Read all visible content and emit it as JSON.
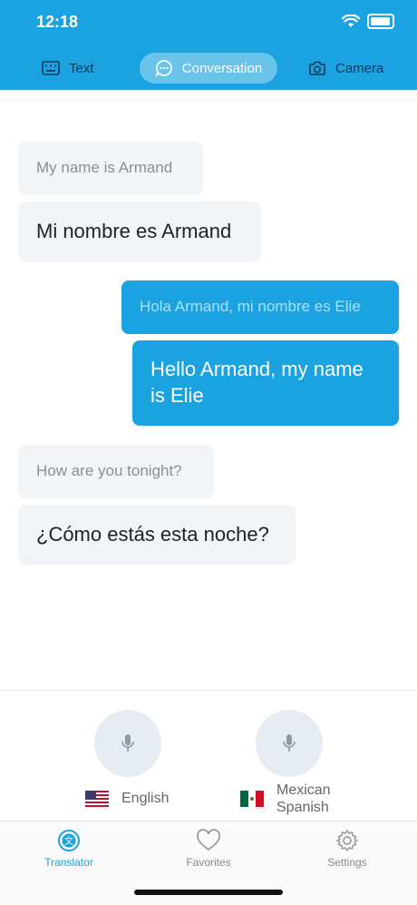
{
  "status_bar": {
    "time": "12:18"
  },
  "tabs": [
    {
      "label": "Text",
      "icon": "keyboard-icon"
    },
    {
      "label": "Conversation",
      "icon": "chat-bubble-icon",
      "active": true
    },
    {
      "label": "Camera",
      "icon": "camera-icon"
    }
  ],
  "messages": [
    {
      "side": "left",
      "source": "My name is Armand",
      "translation": "Mi nombre es Armand"
    },
    {
      "side": "right",
      "source": "Hola Armand, mi nombre es Elie",
      "translation": "Hello Armand, my name is Elie"
    },
    {
      "side": "left",
      "source": "How are you tonight?",
      "translation": "¿Cómo estás esta noche?"
    }
  ],
  "controls": {
    "left": {
      "language": "English",
      "flag": "us-flag-icon"
    },
    "right": {
      "language_line1": "Mexican",
      "language_line2": "Spanish",
      "flag": "mexico-flag-icon"
    }
  },
  "tabbar": [
    {
      "label": "Translator",
      "icon": "translator-icon",
      "active": true
    },
    {
      "label": "Favorites",
      "icon": "heart-icon"
    },
    {
      "label": "Settings",
      "icon": "gear-icon"
    }
  ],
  "colors": {
    "accent": "#1aa3e0",
    "bubble_incoming": "#f2f5f8"
  }
}
